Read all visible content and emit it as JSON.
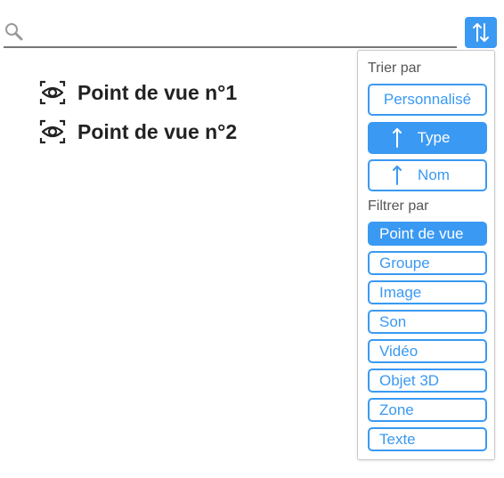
{
  "search": {
    "value": "",
    "placeholder": ""
  },
  "sort_toggle": {
    "icon": "sort-arrows-icon"
  },
  "viewpoints": [
    {
      "label": "Point de vue n°1",
      "icon": "viewpoint-eye-icon"
    },
    {
      "label": "Point de vue n°2",
      "icon": "viewpoint-eye-icon"
    }
  ],
  "sort_panel": {
    "sort_title": "Trier par",
    "sort_options": [
      {
        "label": "Personnalisé",
        "active": false,
        "arrow": false
      },
      {
        "label": "Type",
        "active": true,
        "arrow": "up"
      },
      {
        "label": "Nom",
        "active": false,
        "arrow": "up"
      }
    ],
    "filter_title": "Filtrer par",
    "filter_options": [
      {
        "label": "Point de vue",
        "active": true
      },
      {
        "label": "Groupe",
        "active": false
      },
      {
        "label": "Image",
        "active": false
      },
      {
        "label": "Son",
        "active": false
      },
      {
        "label": "Vidéo",
        "active": false
      },
      {
        "label": "Objet 3D",
        "active": false
      },
      {
        "label": "Zone",
        "active": false
      },
      {
        "label": "Texte",
        "active": false
      }
    ]
  },
  "colors": {
    "accent": "#3a99f2",
    "text": "#222222",
    "muted": "#555555",
    "border": "#c8c8c8"
  }
}
